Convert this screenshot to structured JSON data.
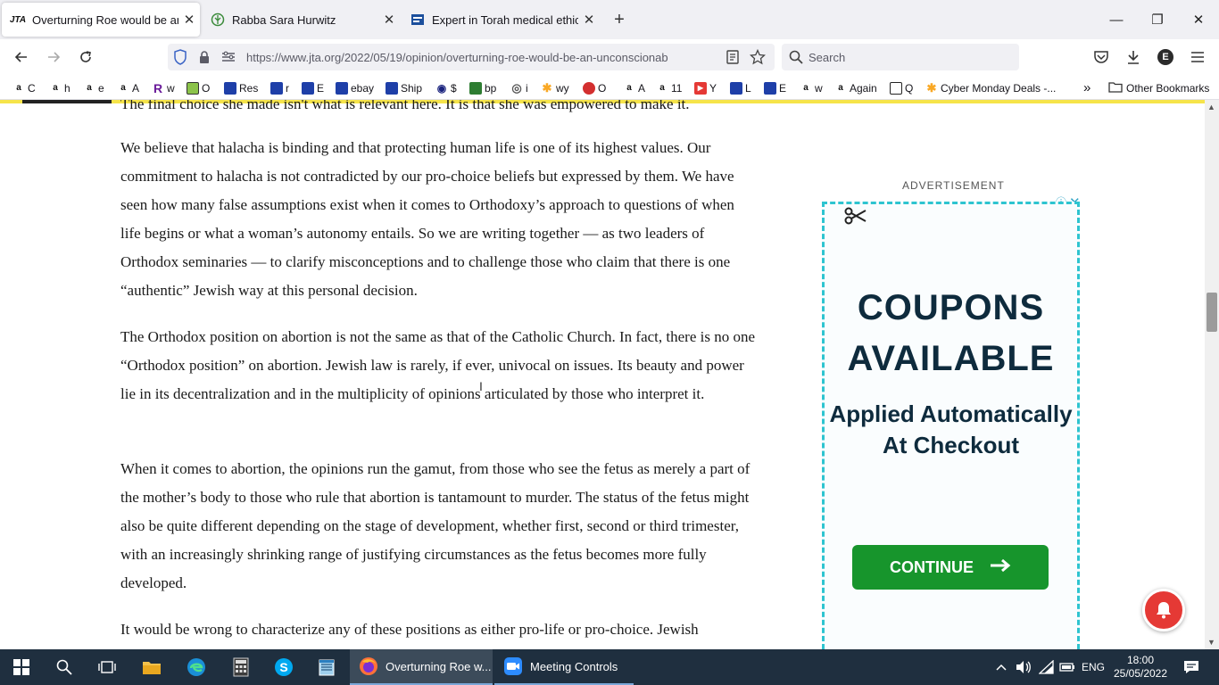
{
  "tabs": [
    {
      "title": "Overturning Roe would be an u",
      "favicon": "JTA",
      "active": true
    },
    {
      "title": "Rabba Sara Hurwitz",
      "favicon": "leaf-icon",
      "active": false
    },
    {
      "title": "Expert in Torah medical ethics:",
      "favicon": "news-icon",
      "active": false
    }
  ],
  "new_tab_label": "+",
  "window_controls": {
    "minimize": "—",
    "restore": "❐",
    "close": "✕"
  },
  "nav": {
    "url": "https://www.jta.org/2022/05/19/opinion/overturning-roe-would-be-an-unconscionab",
    "search_placeholder": "Search"
  },
  "bookmarks": [
    {
      "label": "C",
      "icon": "a",
      "color": "#111111"
    },
    {
      "label": "h",
      "icon": "a",
      "color": "#111111"
    },
    {
      "label": "e",
      "icon": "a",
      "color": "#111111"
    },
    {
      "label": "A",
      "icon": "a",
      "color": "#111111"
    },
    {
      "label": "w",
      "icon": "R",
      "color": "#6a1b9a"
    },
    {
      "label": "O",
      "icon": "◼",
      "color": "#2e7d32"
    },
    {
      "label": "Res",
      "icon": "◼",
      "color": "#1565c0"
    },
    {
      "label": "r",
      "icon": "◼",
      "color": "#1565c0"
    },
    {
      "label": "E",
      "icon": "◼",
      "color": "#1565c0"
    },
    {
      "label": "ebay",
      "icon": "◼",
      "color": "#1565c0"
    },
    {
      "label": "Ship",
      "icon": "◼",
      "color": "#1565c0"
    },
    {
      "label": "$",
      "icon": "◉",
      "color": "#1a237e"
    },
    {
      "label": "bp",
      "icon": "◼",
      "color": "#2e7d32"
    },
    {
      "label": "i",
      "icon": "◎",
      "color": "#555555"
    },
    {
      "label": "wy",
      "icon": "✱",
      "color": "#f9a825"
    },
    {
      "label": "O",
      "icon": "◼",
      "color": "#d32f2f"
    },
    {
      "label": "A",
      "icon": "a",
      "color": "#111111"
    },
    {
      "label": "11",
      "icon": "a",
      "color": "#111111"
    },
    {
      "label": "Y",
      "icon": "▶",
      "color": "#e53935"
    },
    {
      "label": "L",
      "icon": "◼",
      "color": "#1565c0"
    },
    {
      "label": "E",
      "icon": "◼",
      "color": "#1565c0"
    },
    {
      "label": "w",
      "icon": "a",
      "color": "#111111"
    },
    {
      "label": "Again",
      "icon": "a",
      "color": "#111111"
    },
    {
      "label": "Q",
      "icon": "◼",
      "color": "#1565c0"
    },
    {
      "label": "Cyber Monday Deals -...",
      "icon": "✱",
      "color": "#f9a825"
    }
  ],
  "bookmarks_overflow": "»",
  "other_bookmarks": "Other Bookmarks",
  "article": {
    "cut_line": "The final choice she made isn't what is relevant here. It is that she was empowered to make it.",
    "paragraphs": [
      "We believe that halacha is binding and that protecting human life is one of its highest values. Our commitment to halacha is not contradicted by our pro-choice beliefs but expressed by them. We have seen how many false assumptions exist when it comes to Orthodoxy’s approach to questions of when life begins or what a woman’s autonomy entails. So we are writing together — as two leaders of Orthodox seminaries — to clarify misconceptions and to challenge those who claim that there is one “authentic” Jewish way at this personal decision.",
      "The Orthodox position on abortion is not the same as that of the Catholic Church. In fact, there is no one “Orthodox position” on abortion. Jewish law is rarely, if ever, univocal on issues. Its beauty and power lie in its decentralization and in the multiplicity of opinions articulated by those who interpret it.",
      "When it comes to abortion, the opinions run the gamut, from those who see the fetus as merely a part of the mother’s body to those who rule that abortion is tantamount to murder. The status of the fetus might also be quite different depending on the stage of development, whether first, second or third trimester, with an increasingly shrinking range of justifying circumstances as the fetus becomes more fully developed.",
      "It would be wrong to characterize any of these positions as either pro-life or pro-choice. Jewish"
    ]
  },
  "ad": {
    "label": "ADVERTISEMENT",
    "title": "COUPONS AVAILABLE",
    "subtitle": "Applied Automatically At Checkout",
    "button": "CONTINUE",
    "close": "✕",
    "info": "ⓘ"
  },
  "taskbar": {
    "apps": [
      {
        "label": "Overturning Roe w...",
        "active": true
      },
      {
        "label": "Meeting Controls",
        "active": false
      }
    ],
    "language": "ENG",
    "time": "18:00",
    "date": "25/05/2022"
  },
  "colors": {
    "accent_yellow": "#f6e44a",
    "ad_border": "#2ec4d0",
    "ad_button": "#17952c",
    "notification": "#e53935",
    "taskbar": "#1f2f3f"
  }
}
